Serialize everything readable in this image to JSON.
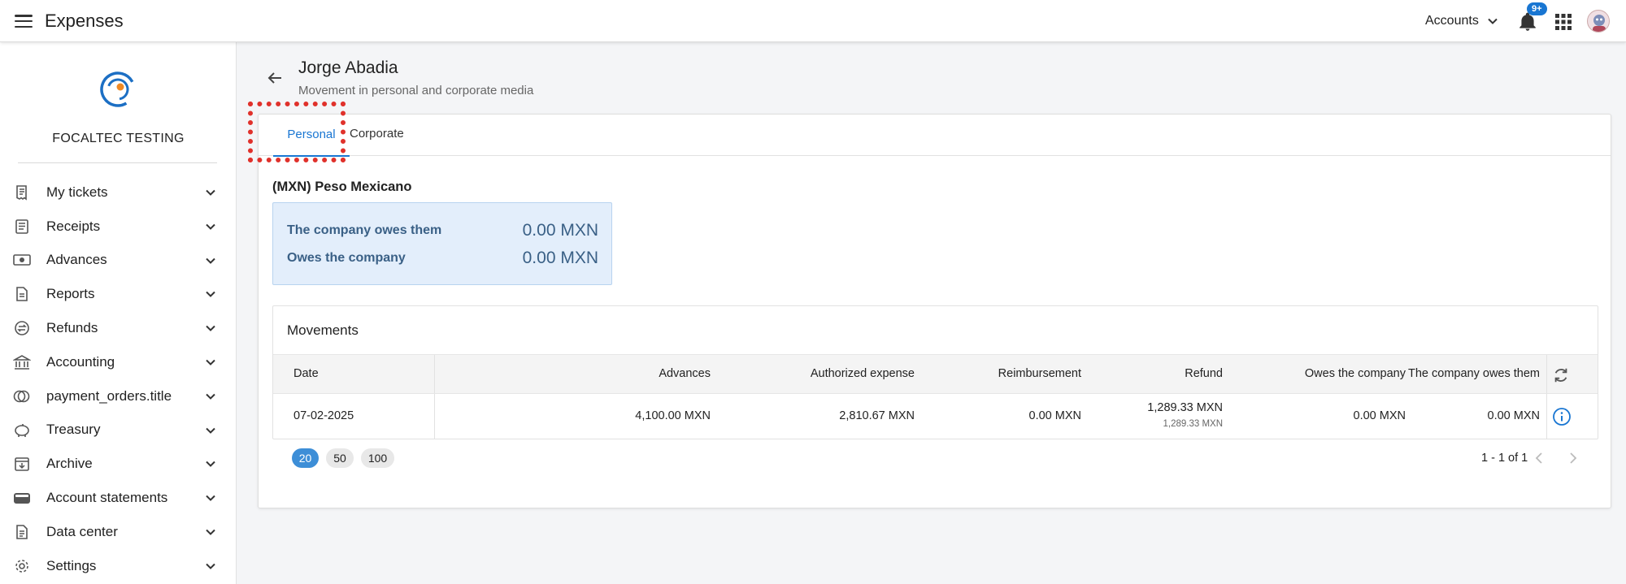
{
  "header": {
    "app_title": "Expenses",
    "accounts_label": "Accounts",
    "notification_badge": "9+"
  },
  "sidebar": {
    "company": "FOCALTEC TESTING",
    "items": [
      {
        "label": "My tickets",
        "icon": "ticket-icon"
      },
      {
        "label": "Receipts",
        "icon": "receipt-icon"
      },
      {
        "label": "Advances",
        "icon": "cash-icon"
      },
      {
        "label": "Reports",
        "icon": "report-icon"
      },
      {
        "label": "Refunds",
        "icon": "refund-icon"
      },
      {
        "label": "Accounting",
        "icon": "bank-icon"
      },
      {
        "label": "payment_orders.title",
        "icon": "payment-orders-icon"
      },
      {
        "label": "Treasury",
        "icon": "piggy-bank-icon"
      },
      {
        "label": "Archive",
        "icon": "archive-icon"
      },
      {
        "label": "Account statements",
        "icon": "wallet-icon"
      },
      {
        "label": "Data center",
        "icon": "data-center-icon"
      },
      {
        "label": "Settings",
        "icon": "gear-icon"
      }
    ]
  },
  "page": {
    "name": "Jorge Abadia",
    "subtitle": "Movement in personal and corporate media"
  },
  "tabs": {
    "personal": "Personal",
    "corporate": "Corporate"
  },
  "currency": {
    "title": "(MXN) Peso Mexicano",
    "company_owes_label": "The company owes them",
    "company_owes_value": "0.00 MXN",
    "owes_company_label": "Owes the company",
    "owes_company_value": "0.00 MXN"
  },
  "movements": {
    "title": "Movements",
    "columns": {
      "date": "Date",
      "advances": "Advances",
      "authorized": "Authorized expense",
      "reimbursement": "Reimbursement",
      "refund": "Refund",
      "owes_company": "Owes the company",
      "company_owes": "The company owes them"
    },
    "rows": [
      {
        "date": "07-02-2025",
        "advances": "4,100.00 MXN",
        "authorized": "2,810.67 MXN",
        "reimbursement": "0.00 MXN",
        "refund": "1,289.33 MXN",
        "refund_sub": "1,289.33 MXN",
        "owes_company": "0.00 MXN",
        "company_owes": "0.00 MXN"
      }
    ]
  },
  "pagination": {
    "sizes": [
      "20",
      "50",
      "100"
    ],
    "selected": "20",
    "range": "1 - 1 of 1"
  },
  "colors": {
    "accent": "#1976d2",
    "balance_bg": "#e3eefb",
    "highlight": "#e0312b"
  }
}
